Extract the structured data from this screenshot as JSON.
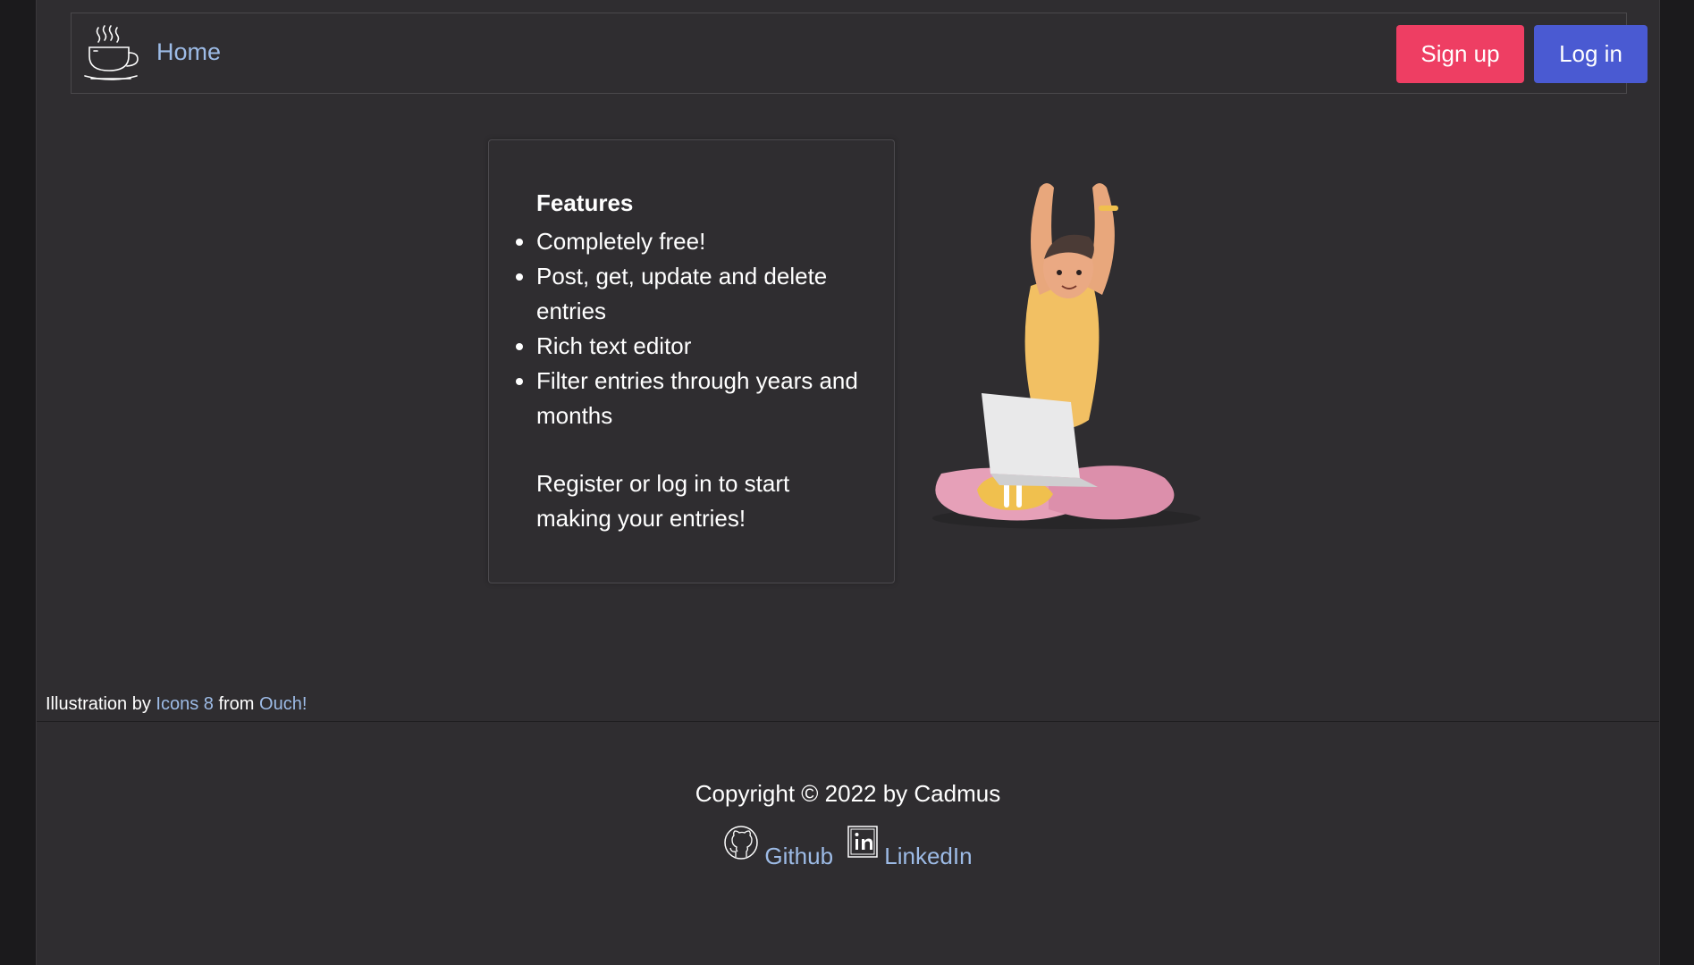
{
  "navbar": {
    "brand_icon": "coffee-cup-icon",
    "home_label": "Home",
    "signup_label": "Sign up",
    "login_label": "Log in"
  },
  "features": {
    "title": "Features",
    "items": [
      "Completely free!",
      "Post, get, update and delete entries",
      "Rich text editor",
      "Filter entries through years and months"
    ],
    "note": "Register or log in to start making your entries!"
  },
  "illustration": {
    "subject": "person-with-laptop-stretching"
  },
  "credit": {
    "prefix": "Illustration by",
    "author": "Icons 8",
    "middle": "from",
    "source": "Ouch!"
  },
  "footer": {
    "copyright": "Copyright © 2022 by Cadmus",
    "github_label": "Github",
    "github_icon": "github-icon",
    "linkedin_label": "LinkedIn",
    "linkedin_icon": "linkedin-icon"
  },
  "colors": {
    "background": "#2f2d30",
    "link": "#9dbbe6",
    "signup": "#ee3e63",
    "login": "#4a5ad2"
  }
}
